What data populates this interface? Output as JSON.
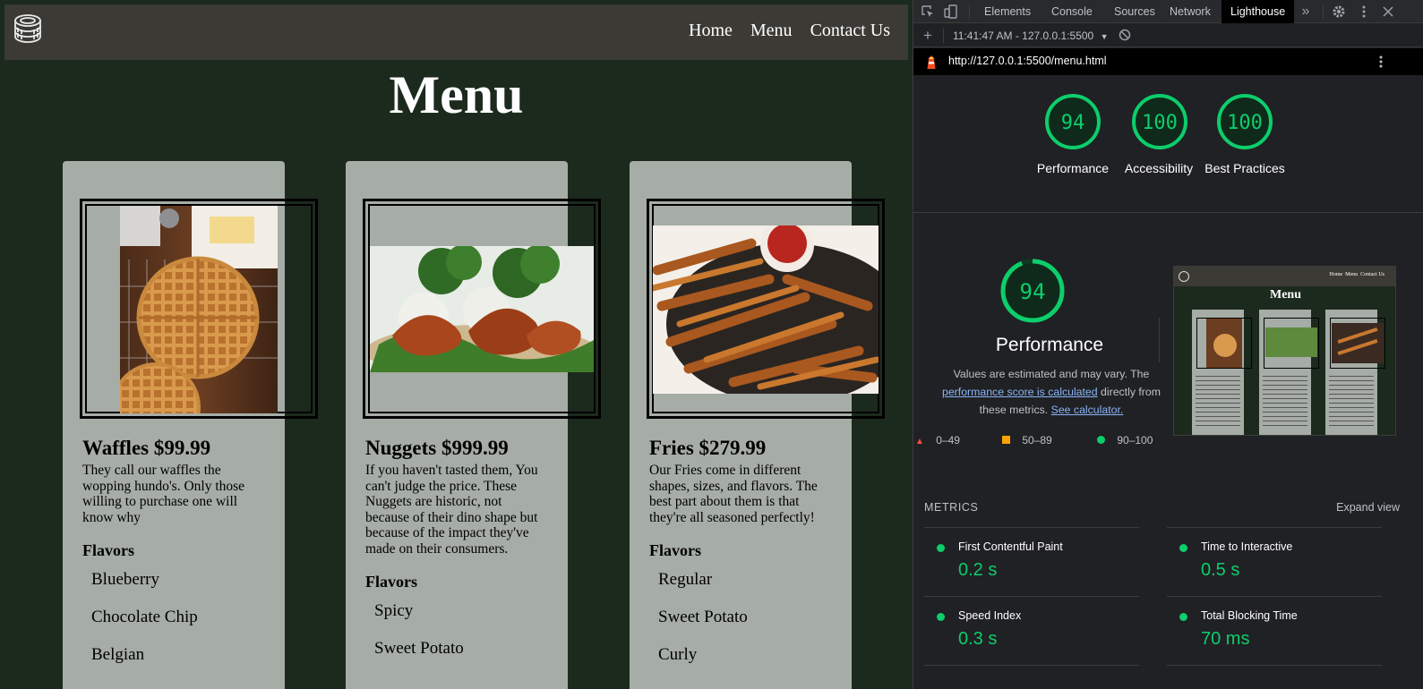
{
  "site": {
    "nav": {
      "home": "Home",
      "menu": "Menu",
      "contact": "Contact Us"
    },
    "title": "Menu",
    "cards": [
      {
        "title": "Waffles $99.99",
        "desc": "They call our waffles the wopping hundo's. Only those willing to purchase one will know why",
        "flavors_head": "Flavors",
        "flavors": [
          "Blueberry",
          "Chocolate Chip",
          "Belgian"
        ]
      },
      {
        "title": "Nuggets $999.99",
        "desc": "If you haven't tasted them, You can't judge the price. These Nuggets are historic, not because of their dino shape but because of the impact they've made on their consumers.",
        "flavors_head": "Flavors",
        "flavors": [
          "Spicy",
          "Sweet Potato"
        ]
      },
      {
        "title": "Fries $279.99",
        "desc": "Our Fries come in different shapes, sizes, and flavors. The best part about them is that they're all seasoned perfectly!",
        "flavors_head": "Flavors",
        "flavors": [
          "Regular",
          "Sweet Potato",
          "Curly"
        ]
      }
    ]
  },
  "devtools": {
    "tabs": [
      "Elements",
      "Console",
      "Sources",
      "Network",
      "Lighthouse"
    ],
    "active_tab": "Lighthouse",
    "overflow": "»",
    "report_select": "11:41:47 AM - 127.0.0.1:5500",
    "url": "http://127.0.0.1:5500/menu.html",
    "scores": [
      {
        "value": "94",
        "label": "Performance"
      },
      {
        "value": "100",
        "label": "Accessibility"
      },
      {
        "value": "100",
        "label": "Best Practices"
      }
    ],
    "perf": {
      "score": "94",
      "title": "Performance",
      "note_1": "Values are estimated and may vary. The",
      "note_link_1": "performance score is calculated",
      "note_2": " directly from these metrics. ",
      "note_link_2": "See calculator."
    },
    "legend": [
      "0–49",
      "50–89",
      "90–100"
    ],
    "thumb": {
      "title": "Menu",
      "nav": "Home  Menu  Contact Us"
    },
    "metrics_head": "METRICS",
    "expand": "Expand view",
    "metrics": [
      {
        "name": "First Contentful Paint",
        "value": "0.2 s"
      },
      {
        "name": "Time to Interactive",
        "value": "0.5 s"
      },
      {
        "name": "Speed Index",
        "value": "0.3 s"
      },
      {
        "name": "Total Blocking Time",
        "value": "70 ms"
      }
    ],
    "colors": {
      "pass": "#0cce6b",
      "average": "#ffa400",
      "fail": "#ff4e42"
    }
  }
}
